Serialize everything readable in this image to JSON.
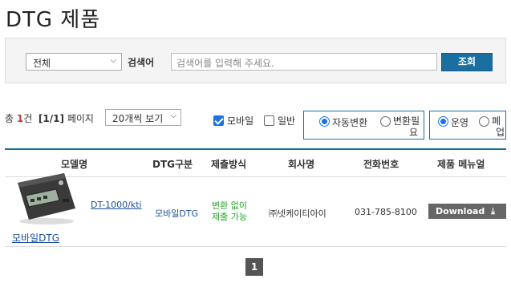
{
  "page": {
    "title": "DTG 제품"
  },
  "search": {
    "category_selected": "전체",
    "label": "검색어",
    "placeholder": "검색어를 입력해 주세요.",
    "button_label": "조회"
  },
  "summary": {
    "total_prefix": "총",
    "total_count": "1",
    "total_suffix": "건",
    "page_info": "[1/1]",
    "page_suffix": "페이지",
    "per_page_selected": "20개씩 보기"
  },
  "filters": {
    "mobile_label": "모바일",
    "mobile_checked": true,
    "general_label": "일반",
    "general_checked": false,
    "auto_convert_label": "자동변환",
    "need_convert_label_1": "변환필",
    "need_convert_label_2": "요",
    "operating_label": "운영",
    "discontinued_label_1": "폐",
    "discontinued_label_2": "업"
  },
  "table": {
    "headers": [
      "모델명",
      "DTG구분",
      "제출방식",
      "회사명",
      "전화번호",
      "제품 메뉴얼"
    ],
    "rows": [
      {
        "model": "DT-1000/kti",
        "image_caption": "모바일DTG",
        "dtg_type": "모바일DTG",
        "submit_method_1": "변환 없이",
        "submit_method_2": "제출 가능",
        "company": "㈜넷케이티아이",
        "phone": "031-785-8100",
        "manual_button": "Download"
      }
    ]
  },
  "pagination": {
    "current": "1"
  }
}
